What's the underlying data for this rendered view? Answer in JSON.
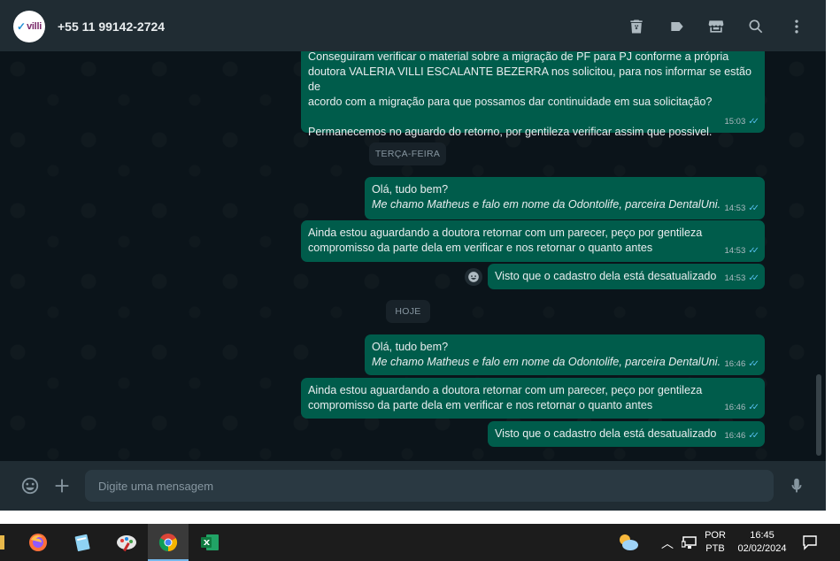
{
  "header": {
    "avatar_text": "villi",
    "contact_name": "+55 11 99142-2724",
    "icons": [
      "delete-icon",
      "label-icon",
      "store-icon",
      "search-icon",
      "menu-icon"
    ]
  },
  "messages": [
    {
      "text": "Conseguiram verificar o material sobre a migração de PF para PJ conforme a própria\ndoutora VALERIA VILLI ESCALANTE BEZERRA nos solicitou, para nos informar se estão de\nacordo com a migração para que possamos dar continuidade em sua solicitação?\n\nPermanecemos no aguardo do retorno, por gentileza verificar assim que possivel.",
      "time": "15:03"
    },
    {
      "line1": "Olá, tudo bem?",
      "line2": "Me chamo Matheus e falo em nome da Odontolife, parceira DentalUni.",
      "time": "14:53"
    },
    {
      "text": "Ainda estou aguardando a doutora retornar com um parecer, peço por gentileza\ncompromisso da parte dela em verificar e nos retornar o quanto antes",
      "time": "14:53"
    },
    {
      "text": "Visto que o cadastro dela está desatualizado",
      "time": "14:53"
    },
    {
      "line1": "Olá, tudo bem?",
      "line2": "Me chamo Matheus e falo em nome da Odontolife, parceira DentalUni.",
      "time": "16:46"
    },
    {
      "text": "Ainda estou aguardando a doutora retornar com um parecer, peço por gentileza\ncompromisso da parte dela em verificar e nos retornar o quanto antes",
      "time": "16:46"
    },
    {
      "text": "Visto que o cadastro dela está desatualizado",
      "time": "16:46"
    }
  ],
  "day_labels": {
    "tuesday": "TERÇA-FEIRA",
    "today": "HOJE"
  },
  "composer": {
    "placeholder": "Digite uma mensagem"
  },
  "tray": {
    "lang_top": "POR",
    "lang_bottom": "PTB",
    "time": "16:45",
    "date": "02/02/2024"
  },
  "colors": {
    "outgoing_bubble": "#005c4b",
    "header_bg": "#202c33",
    "chat_bg": "#0b141a",
    "read_ticks": "#53bdeb"
  }
}
